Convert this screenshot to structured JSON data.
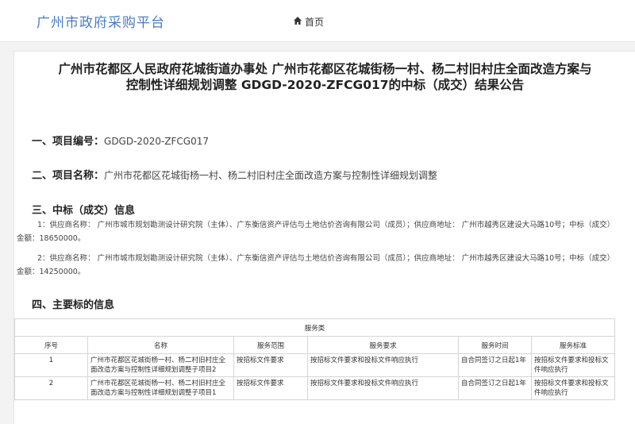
{
  "header": {
    "brand": "广州市政府采购平台",
    "home_label": "首页"
  },
  "notice": {
    "title_line1": "广州市花都区人民政府花城街道办事处 广州市花都区花城街杨一村、杨二村旧村庄全面改造方案与",
    "title_line2": "控制性详细规划调整 GDGD-2020-ZFCG017的中标（成交）结果公告",
    "sec1_head": "一、项目编号：",
    "sec1_value": "GDGD-2020-ZFCG017",
    "sec2_head": "二、项目名称：",
    "sec2_value": "广州市花都区花城街杨一村、杨二村旧村庄全面改造方案与控制性详细规划调整",
    "sec3_head": "三、中标（成交）信息",
    "winner1": "1：供应商名称： 广州市城市规划勘测设计研究院（主体）、广东衡信资产评估与土地估价咨询有限公司（成员）；供应商地址： 广州市越秀区建设大马路10号；中标（成交）金额：18650000。",
    "winner2": "2：供应商名称： 广州市城市规划勘测设计研究院（主体）、广东衡信资产评估与土地估价咨询有限公司（成员）；供应商地址： 广州市越秀区建设大马路10号；中标（成交）金额：14250000。",
    "sec4_head": "四、主要标的信息"
  },
  "table": {
    "caption": "服务类",
    "headers": [
      "序号",
      "名称",
      "服务范围",
      "服务要求",
      "服务时间",
      "服务标准"
    ],
    "rows": [
      [
        "1",
        "广州市花都区花城街杨一村、杨二村旧村庄全面改造方案与控制性详细规划调整子项目2",
        "按招标文件要求",
        "按招标文件要求和投标文件响应执行",
        "自合同签订之日起1年",
        "按招标文件要求和投标文件响应执行"
      ],
      [
        "2",
        "广州市花都区花城街杨一村、杨二村旧村庄全面改造方案与控制性详细规划调整子项目1",
        "按招标文件要求",
        "按招标文件要求和投标文件响应执行",
        "自合同签订之日起1年",
        "按招标文件要求和投标文件响应执行"
      ]
    ]
  },
  "colors": {
    "brand": "#4a7bc4",
    "background": "#f3f3f3"
  },
  "icons": {
    "home": "home-icon"
  }
}
